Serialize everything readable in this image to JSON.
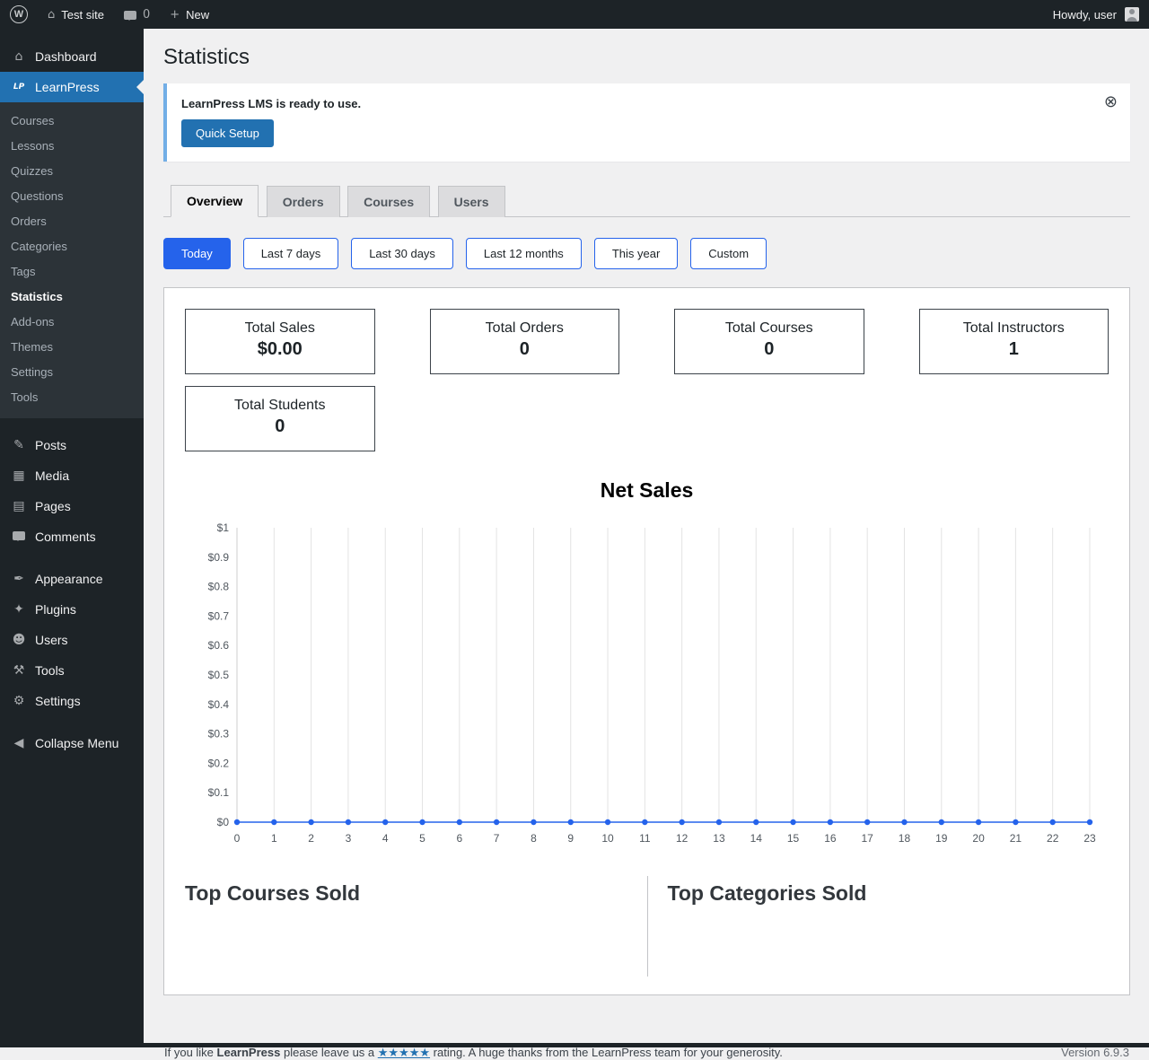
{
  "colors": {
    "wp_blue": "#2271b1",
    "lp_accent": "#2563eb",
    "sidebar_bg": "#1d2327",
    "page_bg": "#f0f0f1",
    "notice_border": "#72aee6"
  },
  "admin_bar": {
    "site_name": "Test site",
    "comments_count": "0",
    "new_label": "New",
    "howdy": "Howdy, user"
  },
  "icons": {
    "wp_logo": "W",
    "home": "⌂",
    "plus": "+",
    "dashboard": "⌂",
    "learnpress": "LP",
    "posts": "✎",
    "media": "▦",
    "pages": "▤",
    "appearance": "✒",
    "plugins": "✦",
    "users": "☻",
    "tools": "⚒",
    "settings": "⚙",
    "collapse": "◀",
    "dismiss": "⊗"
  },
  "sidebar": {
    "dashboard": "Dashboard",
    "learnpress": "LearnPress",
    "learnpress_submenu": [
      "Courses",
      "Lessons",
      "Quizzes",
      "Questions",
      "Orders",
      "Categories",
      "Tags",
      "Statistics",
      "Add-ons",
      "Themes",
      "Settings",
      "Tools"
    ],
    "current_submenu": "Statistics",
    "menu_mid": [
      "Posts",
      "Media",
      "Pages",
      "Comments"
    ],
    "menu_low": [
      "Appearance",
      "Plugins",
      "Users",
      "Tools",
      "Settings"
    ],
    "collapse": "Collapse Menu"
  },
  "page": {
    "title": "Statistics",
    "notice": {
      "message": "LearnPress LMS is ready to use.",
      "button_label": "Quick Setup"
    },
    "tabs": [
      "Overview",
      "Orders",
      "Courses",
      "Users"
    ],
    "active_tab": "Overview",
    "filters": [
      "Today",
      "Last 7 days",
      "Last 30 days",
      "Last 12 months",
      "This year",
      "Custom"
    ],
    "active_filter": "Today",
    "stats": [
      {
        "label": "Total Sales",
        "value": "$0.00"
      },
      {
        "label": "Total Orders",
        "value": "0"
      },
      {
        "label": "Total Courses",
        "value": "0"
      },
      {
        "label": "Total Instructors",
        "value": "1"
      },
      {
        "label": "Total Students",
        "value": "0"
      }
    ],
    "sections": {
      "top_courses": "Top Courses Sold",
      "top_categories": "Top Categories Sold"
    }
  },
  "chart_data": {
    "type": "line",
    "title": "Net Sales",
    "x": [
      0,
      1,
      2,
      3,
      4,
      5,
      6,
      7,
      8,
      9,
      10,
      11,
      12,
      13,
      14,
      15,
      16,
      17,
      18,
      19,
      20,
      21,
      22,
      23
    ],
    "series": [
      {
        "name": "Net Sales",
        "values": [
          0,
          0,
          0,
          0,
          0,
          0,
          0,
          0,
          0,
          0,
          0,
          0,
          0,
          0,
          0,
          0,
          0,
          0,
          0,
          0,
          0,
          0,
          0,
          0
        ]
      }
    ],
    "ylim": [
      0,
      1
    ],
    "ytick_labels": [
      "$0",
      "$0.1",
      "$0.2",
      "$0.3",
      "$0.4",
      "$0.5",
      "$0.6",
      "$0.7",
      "$0.8",
      "$0.9",
      "$1"
    ],
    "xlabel": "",
    "ylabel": "",
    "grid": "vertical",
    "legend": "none",
    "line_color": "#2563eb",
    "point_color": "#2563eb"
  },
  "footer": {
    "prefix": "If you like ",
    "brand": "LearnPress",
    "middle": " please leave us a ",
    "stars": "★★★★★",
    "suffix": " rating. A huge thanks from the LearnPress team for your generosity.",
    "version": "Version 6.9.3"
  }
}
